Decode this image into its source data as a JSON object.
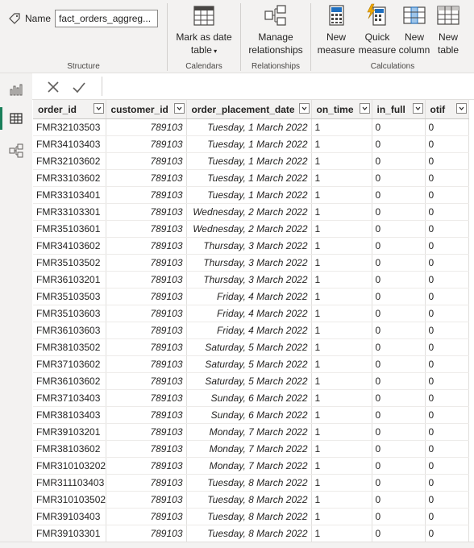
{
  "ribbon": {
    "name_label": "Name",
    "name_value": "fact_orders_aggreg...",
    "groups": {
      "structure": "Structure",
      "calendars": "Calendars",
      "relationships": "Relationships",
      "calculations": "Calculations"
    },
    "buttons": {
      "mark_date_line1": "Mark as date",
      "mark_date_line2": "table",
      "manage_rel_line1": "Manage",
      "manage_rel_line2": "relationships",
      "new_measure_line1": "New",
      "new_measure_line2": "measure",
      "quick_measure_line1": "Quick",
      "quick_measure_line2": "measure",
      "new_column_line1": "New",
      "new_column_line2": "column",
      "new_table_line1": "New",
      "new_table_line2": "table"
    }
  },
  "table": {
    "columns": [
      "order_id",
      "customer_id",
      "order_placement_date",
      "on_time",
      "in_full",
      "otif"
    ],
    "rows": [
      [
        "FMR32103503",
        "789103",
        "Tuesday, 1 March 2022",
        "1",
        "0",
        "0"
      ],
      [
        "FMR34103403",
        "789103",
        "Tuesday, 1 March 2022",
        "1",
        "0",
        "0"
      ],
      [
        "FMR32103602",
        "789103",
        "Tuesday, 1 March 2022",
        "1",
        "0",
        "0"
      ],
      [
        "FMR33103602",
        "789103",
        "Tuesday, 1 March 2022",
        "1",
        "0",
        "0"
      ],
      [
        "FMR33103401",
        "789103",
        "Tuesday, 1 March 2022",
        "1",
        "0",
        "0"
      ],
      [
        "FMR33103301",
        "789103",
        "Wednesday, 2 March 2022",
        "1",
        "0",
        "0"
      ],
      [
        "FMR35103601",
        "789103",
        "Wednesday, 2 March 2022",
        "1",
        "0",
        "0"
      ],
      [
        "FMR34103602",
        "789103",
        "Thursday, 3 March 2022",
        "1",
        "0",
        "0"
      ],
      [
        "FMR35103502",
        "789103",
        "Thursday, 3 March 2022",
        "1",
        "0",
        "0"
      ],
      [
        "FMR36103201",
        "789103",
        "Thursday, 3 March 2022",
        "1",
        "0",
        "0"
      ],
      [
        "FMR35103503",
        "789103",
        "Friday, 4 March 2022",
        "1",
        "0",
        "0"
      ],
      [
        "FMR35103603",
        "789103",
        "Friday, 4 March 2022",
        "1",
        "0",
        "0"
      ],
      [
        "FMR36103603",
        "789103",
        "Friday, 4 March 2022",
        "1",
        "0",
        "0"
      ],
      [
        "FMR38103502",
        "789103",
        "Saturday, 5 March 2022",
        "1",
        "0",
        "0"
      ],
      [
        "FMR37103602",
        "789103",
        "Saturday, 5 March 2022",
        "1",
        "0",
        "0"
      ],
      [
        "FMR36103602",
        "789103",
        "Saturday, 5 March 2022",
        "1",
        "0",
        "0"
      ],
      [
        "FMR37103403",
        "789103",
        "Sunday, 6 March 2022",
        "1",
        "0",
        "0"
      ],
      [
        "FMR38103403",
        "789103",
        "Sunday, 6 March 2022",
        "1",
        "0",
        "0"
      ],
      [
        "FMR39103201",
        "789103",
        "Monday, 7 March 2022",
        "1",
        "0",
        "0"
      ],
      [
        "FMR38103602",
        "789103",
        "Monday, 7 March 2022",
        "1",
        "0",
        "0"
      ],
      [
        "FMR310103202",
        "789103",
        "Monday, 7 March 2022",
        "1",
        "0",
        "0"
      ],
      [
        "FMR311103403",
        "789103",
        "Tuesday, 8 March 2022",
        "1",
        "0",
        "0"
      ],
      [
        "FMR310103502",
        "789103",
        "Tuesday, 8 March 2022",
        "1",
        "0",
        "0"
      ],
      [
        "FMR39103403",
        "789103",
        "Tuesday, 8 March 2022",
        "1",
        "0",
        "0"
      ],
      [
        "FMR39103301",
        "789103",
        "Tuesday, 8 March 2022",
        "1",
        "0",
        "0"
      ]
    ]
  },
  "colors": {
    "accent": "#1a7f5a",
    "ribbon_bg": "#f3f2f1",
    "header_bg": "#f3f2f1"
  }
}
